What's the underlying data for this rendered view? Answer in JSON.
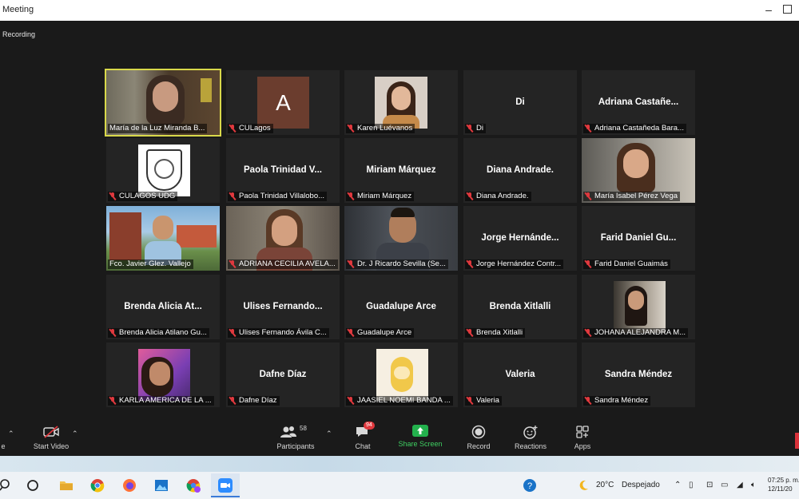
{
  "window": {
    "title": "Meeting"
  },
  "status": {
    "recording_label": "Recording"
  },
  "tiles": [
    {
      "caption": "María de la Luz Miranda B...",
      "name": "",
      "mic_muted": false
    },
    {
      "caption": "CULagos",
      "name": "",
      "letter": "A",
      "mic_muted": true
    },
    {
      "caption": "Karen Luévanos",
      "name": "",
      "mic_muted": true
    },
    {
      "caption": "Di",
      "name": "Di",
      "mic_muted": true
    },
    {
      "caption": "Adriana Castañeda Bara...",
      "name": "Adriana  Castañe...",
      "mic_muted": true
    },
    {
      "caption": "CULAGOS UDG",
      "name": "",
      "mic_muted": true
    },
    {
      "caption": "Paola Trinidad Villalobo...",
      "name": "Paola  Trinidad  V...",
      "mic_muted": true
    },
    {
      "caption": "Miriam Márquez",
      "name": "Miriam  Márquez",
      "mic_muted": true
    },
    {
      "caption": "Diana Andrade.",
      "name": "Diana  Andrade.",
      "mic_muted": true
    },
    {
      "caption": "María Isabel Pérez Vega",
      "name": "",
      "mic_muted": true
    },
    {
      "caption": "Fco. Javier Glez. Vallejo",
      "name": "",
      "mic_muted": false
    },
    {
      "caption": "ADRIANA CECILIA AVELA...",
      "name": "",
      "mic_muted": true
    },
    {
      "caption": "Dr. J Ricardo Sevilla (Se...",
      "name": "",
      "mic_muted": true
    },
    {
      "caption": "Jorge Hernández Contr...",
      "name": "Jorge  Hernánde...",
      "mic_muted": true
    },
    {
      "caption": "Farid Daniel Guaimás",
      "name": "Farid  Daniel  Gu...",
      "mic_muted": true
    },
    {
      "caption": "Brenda Alicia Atilano Gu...",
      "name": "Brenda  Alicia  At...",
      "mic_muted": true
    },
    {
      "caption": "Ulises Fernando Ávila C...",
      "name": "Ulises  Fernando...",
      "mic_muted": true
    },
    {
      "caption": "Guadalupe Arce",
      "name": "Guadalupe  Arce",
      "mic_muted": true
    },
    {
      "caption": "Brenda Xitlalli",
      "name": "Brenda  Xitlalli",
      "mic_muted": true
    },
    {
      "caption": "JOHANA ALEJANDRA M...",
      "name": "",
      "mic_muted": true
    },
    {
      "caption": "KARLA AMERICA DE LA ...",
      "name": "",
      "mic_muted": true
    },
    {
      "caption": "Dafne Díaz",
      "name": "Dafne  Díaz",
      "mic_muted": true
    },
    {
      "caption": "JAASIEL NOEMI BANDA ...",
      "name": "",
      "mic_muted": true
    },
    {
      "caption": "Valeria",
      "name": "Valeria",
      "mic_muted": true
    },
    {
      "caption": "Sandra Méndez",
      "name": "Sandra  Méndez",
      "mic_muted": true
    }
  ],
  "toolbar": {
    "mute_label": "e",
    "start_video_label": "Start Video",
    "participants_label": "Participants",
    "participants_count": "58",
    "chat_label": "Chat",
    "chat_badge": "94",
    "share_label": "Share Screen",
    "record_label": "Record",
    "reactions_label": "Reactions",
    "apps_label": "Apps"
  },
  "taskbar": {
    "weather_temp": "20°C",
    "weather_desc": "Despejado",
    "time": "07:25 p. m.",
    "date": "12/11/20"
  },
  "colors": {
    "accent_share": "#23b14d",
    "muted_mic": "#e0393e",
    "active_speaker": "#d9d94a"
  }
}
